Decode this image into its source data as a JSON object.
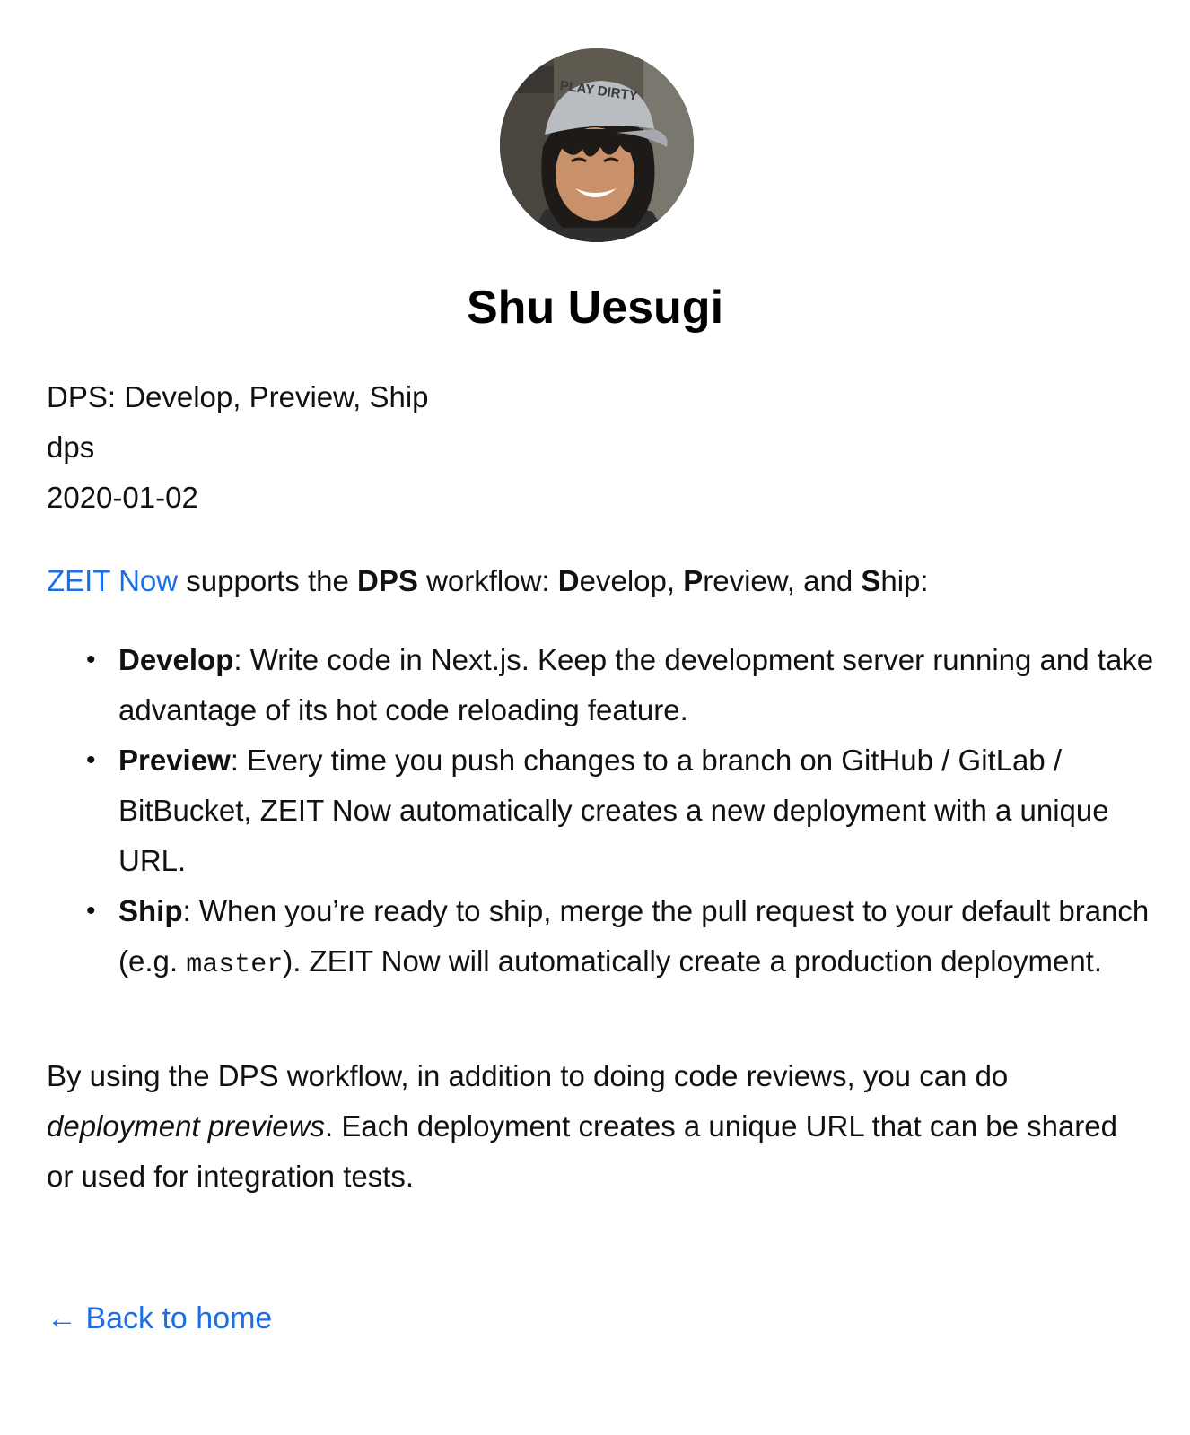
{
  "author": {
    "name": "Shu Uesugi",
    "avatar_icon": "profile-photo-avatar",
    "cap_text": "PLAY DIRTY"
  },
  "post": {
    "title": "DPS: Develop, Preview, Ship",
    "id": "dps",
    "date": "2020-01-02"
  },
  "intro": {
    "link_text": "ZEIT Now",
    "text_1": " supports the ",
    "bold_dps": "DPS",
    "text_2": " workflow: ",
    "d": "D",
    "evelop": "evelop, ",
    "p": "P",
    "review": "review, and ",
    "s": "S",
    "hip": "hip:"
  },
  "steps": [
    {
      "label": "Develop",
      "text": ": Write code in Next.js. Keep the development server running and take advantage of its hot code reloading feature."
    },
    {
      "label": "Preview",
      "text": ": Every time you push changes to a branch on GitHub / GitLab / BitBucket, ZEIT Now automatically creates a new deployment with a unique URL."
    },
    {
      "label": "Ship",
      "text_before": ": When you’re ready to ship, merge the pull request to your default branch (e.g. ",
      "code": "master",
      "text_after": "). ZEIT Now will automatically create a production deployment."
    }
  ],
  "bullet_char": "•",
  "outro": {
    "text_1": "By using the DPS workflow, in addition to doing code reviews, you can do ",
    "italic": "deployment previews",
    "text_2": ". Each deployment creates a unique URL that can be shared or used for integration tests."
  },
  "back_link": {
    "arrow": "←",
    "label": "Back to home"
  },
  "colors": {
    "link": "#1a6ee8",
    "text": "#111111"
  }
}
